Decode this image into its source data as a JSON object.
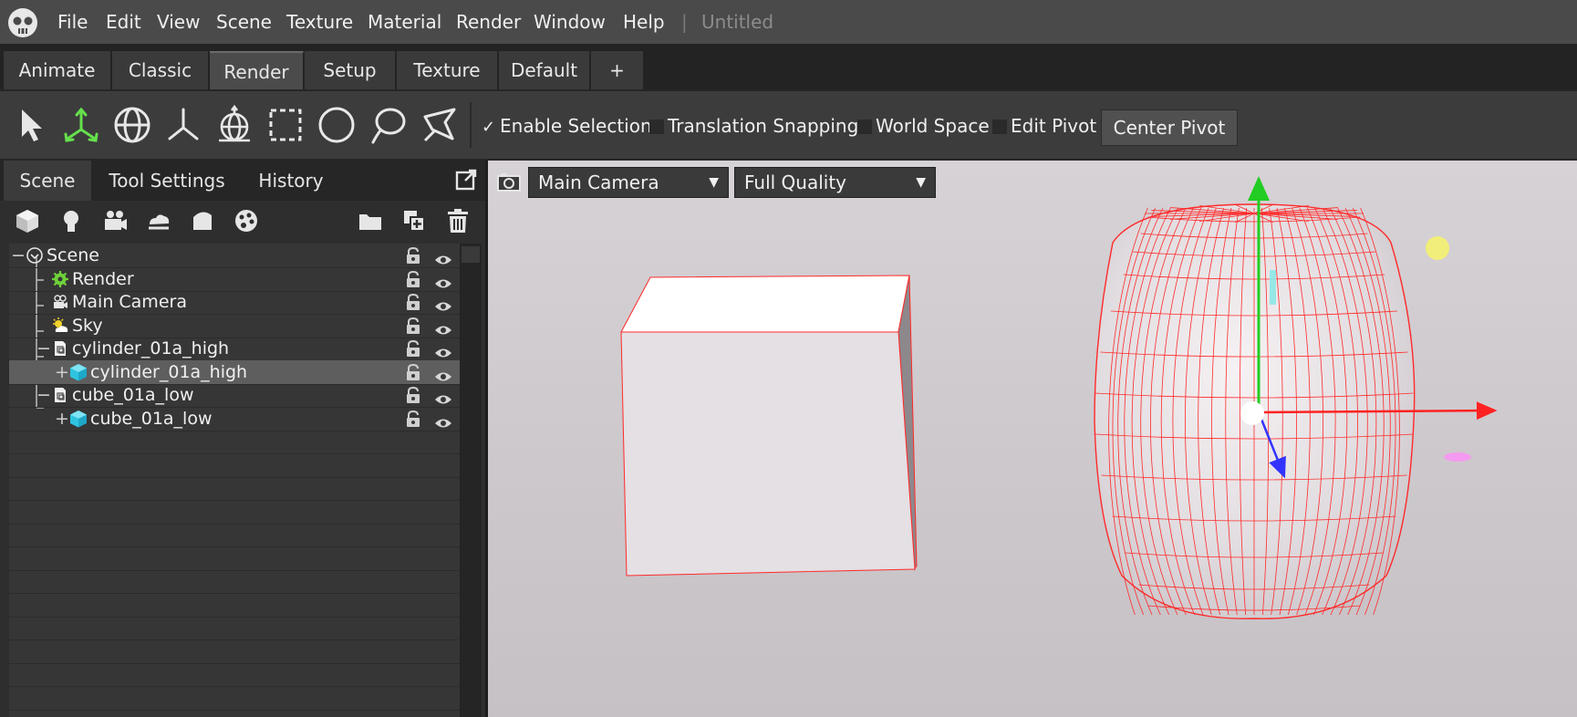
{
  "menubar": {
    "items": [
      "File",
      "Edit",
      "View",
      "Scene",
      "Texture",
      "Material",
      "Render",
      "Window",
      "Help"
    ],
    "separator": "|",
    "document_title": "Untitled"
  },
  "workspace_tabs": {
    "tabs": [
      "Animate",
      "Classic",
      "Render",
      "Setup",
      "Texture",
      "Default",
      "+"
    ],
    "active": "Render"
  },
  "toolbar": {
    "tools": [
      "select-arrow-icon",
      "move-gizmo-icon",
      "rotate-gizmo-icon",
      "scale-axes-icon",
      "universal-gizmo-icon",
      "box-select-icon",
      "circle-select-icon",
      "lasso-select-icon",
      "polygon-select-icon"
    ],
    "enable_selection": {
      "label": "Enable Selection",
      "checked": true,
      "mark": "✓"
    },
    "translation_snapping": {
      "label": "Translation Snapping",
      "checked": false
    },
    "world_space": {
      "label": "World Space",
      "checked": false
    },
    "edit_pivot": {
      "label": "Edit Pivot",
      "checked": false
    },
    "center_pivot_label": "Center Pivot"
  },
  "left_panel": {
    "tabs": [
      "Scene",
      "Tool Settings",
      "History"
    ],
    "active_tab": "Scene",
    "icons": [
      "add-mesh-icon",
      "add-light-icon",
      "add-camera-icon",
      "add-sky-icon",
      "add-shape-icon",
      "add-material-icon",
      "folder-icon",
      "duplicate-icon",
      "trash-icon"
    ],
    "tree": [
      {
        "label": "Scene",
        "icon": "scene-icon",
        "depth": 0,
        "expander": "−",
        "selected": false
      },
      {
        "label": "Render",
        "icon": "render-gear-icon",
        "depth": 1,
        "expander": "",
        "selected": false
      },
      {
        "label": "Main Camera",
        "icon": "camera-icon",
        "depth": 1,
        "expander": "",
        "selected": false
      },
      {
        "label": "Sky",
        "icon": "sky-icon",
        "depth": 1,
        "expander": "",
        "selected": false
      },
      {
        "label": "cylinder_01a_high",
        "icon": "mesh-file-icon",
        "depth": 1,
        "expander": "−",
        "selected": false
      },
      {
        "label": "cylinder_01a_high",
        "icon": "mesh-cube-icon",
        "depth": 2,
        "expander": "+",
        "selected": true
      },
      {
        "label": "cube_01a_low",
        "icon": "mesh-file-icon",
        "depth": 1,
        "expander": "−",
        "selected": false
      },
      {
        "label": "cube_01a_low",
        "icon": "mesh-cube-icon",
        "depth": 2,
        "expander": "+",
        "selected": false
      }
    ]
  },
  "viewport": {
    "camera_select": "Main Camera",
    "quality_select": "Full Quality",
    "colors": {
      "wireframe": "#ff2a2a",
      "axis_x": "#ff2222",
      "axis_y": "#22cc22",
      "axis_z": "#3333ff",
      "light": "#f2ee7a"
    }
  }
}
